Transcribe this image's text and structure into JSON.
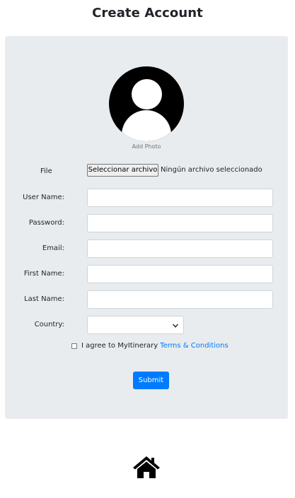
{
  "header": {
    "title": "Create Account"
  },
  "form": {
    "avatar_caption": "Add Photo",
    "file": {
      "label": "File",
      "button_label": "Seleccionar archivo",
      "status": "Ningún archivo seleccionado"
    },
    "fields": [
      {
        "label": "User Name:",
        "value": ""
      },
      {
        "label": "Password:",
        "value": ""
      },
      {
        "label": "Email:",
        "value": ""
      },
      {
        "label": "First Name:",
        "value": ""
      },
      {
        "label": "Last Name:",
        "value": ""
      }
    ],
    "country": {
      "label": "Country:",
      "selected": ""
    },
    "terms": {
      "text": "I agree to MyItinerary",
      "link": "Terms & Conditions",
      "checked": false
    },
    "submit_label": "Submit"
  },
  "footer": {
    "icon": "home-icon"
  },
  "colors": {
    "card_bg": "#e9ecef",
    "primary": "#007bff"
  }
}
